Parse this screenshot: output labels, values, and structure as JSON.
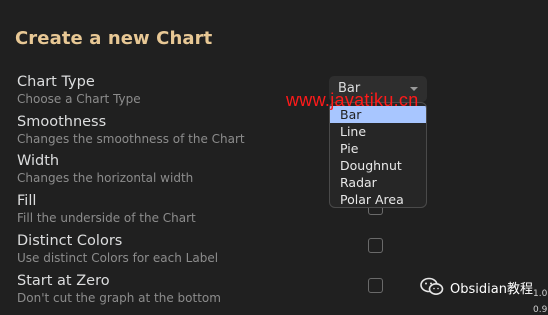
{
  "modal": {
    "title": "Create a new Chart"
  },
  "settings": [
    {
      "name": "Chart Type",
      "desc": "Choose a Chart Type"
    },
    {
      "name": "Smoothness",
      "desc": "Changes the smoothness of the Chart"
    },
    {
      "name": "Width",
      "desc": "Changes the horizontal width"
    },
    {
      "name": "Fill",
      "desc": "Fill the underside of the Chart"
    },
    {
      "name": "Distinct Colors",
      "desc": "Use distinct Colors for each Label"
    },
    {
      "name": "Start at Zero",
      "desc": "Don't cut the graph at the bottom"
    }
  ],
  "chart_type_select": {
    "value": "Bar",
    "options": [
      "Bar",
      "Line",
      "Pie",
      "Doughnut",
      "Radar",
      "Polar Area"
    ],
    "highlighted_index": 0
  },
  "checkboxes": {
    "fill": false,
    "distinct_colors": false,
    "start_at_zero": false
  },
  "watermark": {
    "text": "www.javatiku.cn",
    "color": "#ff1a1a"
  },
  "wechat_badge": {
    "text": "Obsidian教程",
    "icon": "wechat-icon"
  },
  "edge_numbers": [
    "1.0",
    "0.9"
  ],
  "colors": {
    "title": "#e8c895",
    "highlight": "#a8c6ff",
    "background": "#202020"
  }
}
